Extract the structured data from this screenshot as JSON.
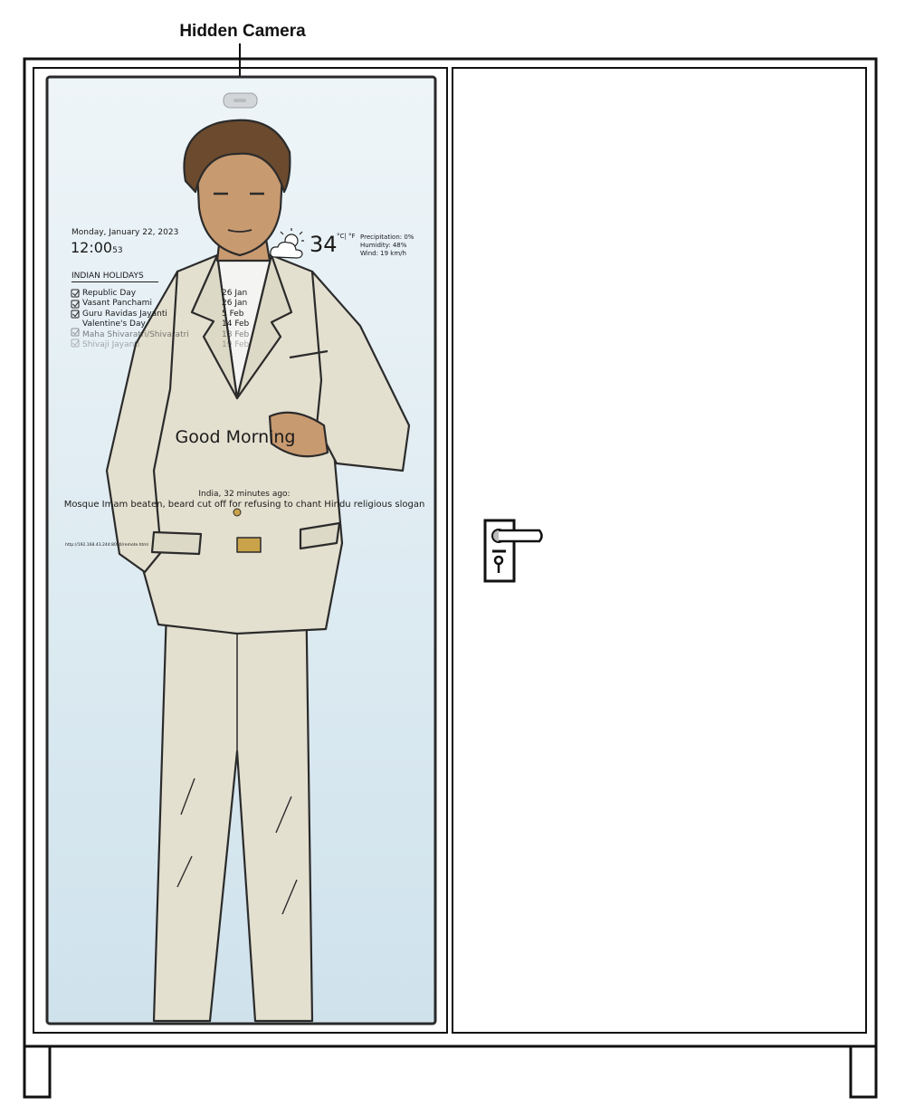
{
  "callout": {
    "label": "Hidden Camera"
  },
  "mirror": {
    "date": "Monday, January 22, 2023",
    "time": "12:00",
    "seconds": "53",
    "weather": {
      "icon": "partly-cloudy-icon",
      "temperature": "34",
      "units": "°C| °F",
      "precipitation": "Precipitation: 0%",
      "humidity": "Humidity: 48%",
      "wind": "Wind: 19 km/h"
    },
    "holidays": {
      "title": "INDIAN HOLIDAYS",
      "items": [
        {
          "name": "Republic Day",
          "date": "26 Jan"
        },
        {
          "name": "Vasant Panchami",
          "date": "26 Jan"
        },
        {
          "name": "Guru Ravidas Jayanti",
          "date": "5 Feb"
        },
        {
          "name": "Valentine's Day",
          "date": "14 Feb"
        },
        {
          "name": "Maha Shivaratri/Shivaratri",
          "date": "18 Feb"
        },
        {
          "name": "Shivaji Jayanti",
          "date": "19 Feb"
        }
      ]
    },
    "greeting": "Good Morning",
    "news": {
      "source": "India, 32 minutes ago:",
      "headline": "Mosque Imam beaten, beard cut off for refusing to chant Hindu religious slogan"
    },
    "remote_url": "http://192.168.43.244:8080/remote.html"
  },
  "colors": {
    "outline": "#111111",
    "mirror_top": "#eef5f8",
    "mirror_bottom": "#cfe2ec",
    "suit": "#e4e0d0",
    "skin": "#c89a70",
    "hair": "#6b4a2e"
  }
}
